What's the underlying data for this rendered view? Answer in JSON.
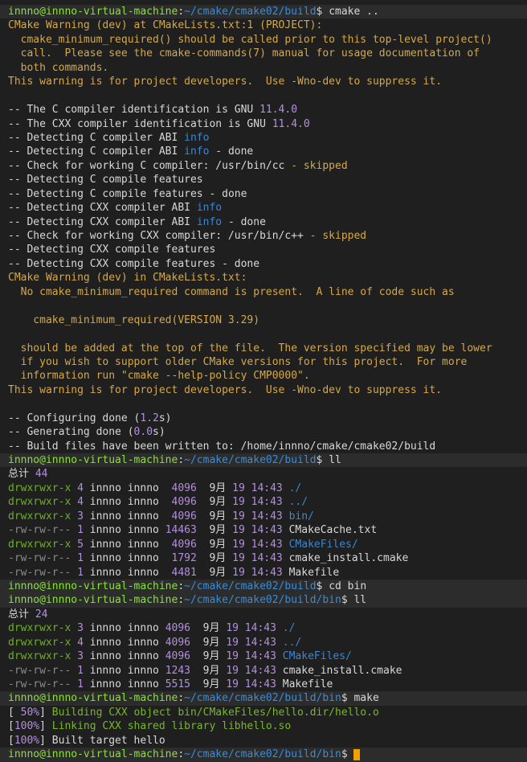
{
  "prompt": {
    "user_host": "innno@innno-virtual-machine",
    "path_build": "~/cmake/cmake02/build",
    "path_bin": "~/cmake/cmake02/build/bin"
  },
  "commands": [
    "cmake ..",
    "ll",
    "cd bin",
    "ll",
    "make"
  ],
  "cmake_output": [
    "CMake Warning (dev) at CMakeLists.txt:1 (PROJECT):",
    "  cmake_minimum_required() should be called prior to this top-level project()",
    "  call.  Please see the cmake-commands(7) manual for usage documentation of",
    "  both commands.",
    "This warning is for project developers.  Use -Wno-dev to suppress it.",
    "",
    "-- The C compiler identification is GNU 11.4.0",
    "-- The CXX compiler identification is GNU 11.4.0",
    "-- Detecting C compiler ABI info",
    "-- Detecting C compiler ABI info - done",
    "-- Check for working C compiler: /usr/bin/cc - skipped",
    "-- Detecting C compile features",
    "-- Detecting C compile features - done",
    "-- Detecting CXX compiler ABI info",
    "-- Detecting CXX compiler ABI info - done",
    "-- Check for working CXX compiler: /usr/bin/c++ - skipped",
    "-- Detecting CXX compile features",
    "-- Detecting CXX compile features - done",
    "CMake Warning (dev) in CMakeLists.txt:",
    "  No cmake_minimum_required command is present.  A line of code such as",
    "",
    "    cmake_minimum_required(VERSION 3.29)",
    "",
    "  should be added at the top of the file.  The version specified may be lower",
    "  if you wish to support older CMake versions for this project.  For more",
    "  information run \"cmake --help-policy CMP0000\".",
    "This warning is for project developers.  Use -Wno-dev to suppress it.",
    "",
    "-- Configuring done (1.2s)",
    "-- Generating done (0.0s)",
    "-- Build files have been written to: /home/innno/cmake/cmake02/build"
  ],
  "ll_build": {
    "total": "总计 44",
    "rows": [
      {
        "perm": "drwxrwxr-x",
        "links": "4",
        "owner": "innno",
        "group": "innno",
        "size": " 4096",
        "month": "9月",
        "day": "19",
        "time": "14:43",
        "name": "./",
        "type": "dir"
      },
      {
        "perm": "drwxrwxr-x",
        "links": "4",
        "owner": "innno",
        "group": "innno",
        "size": " 4096",
        "month": "9月",
        "day": "19",
        "time": "14:43",
        "name": "../",
        "type": "dir"
      },
      {
        "perm": "drwxrwxr-x",
        "links": "3",
        "owner": "innno",
        "group": "innno",
        "size": " 4096",
        "month": "9月",
        "day": "19",
        "time": "14:43",
        "name": "bin/",
        "type": "dir"
      },
      {
        "perm": "-rw-rw-r--",
        "links": "1",
        "owner": "innno",
        "group": "innno",
        "size": "14463",
        "month": "9月",
        "day": "19",
        "time": "14:43",
        "name": "CMakeCache.txt",
        "type": "file"
      },
      {
        "perm": "drwxrwxr-x",
        "links": "5",
        "owner": "innno",
        "group": "innno",
        "size": " 4096",
        "month": "9月",
        "day": "19",
        "time": "14:43",
        "name": "CMakeFiles/",
        "type": "dir"
      },
      {
        "perm": "-rw-rw-r--",
        "links": "1",
        "owner": "innno",
        "group": "innno",
        "size": " 1792",
        "month": "9月",
        "day": "19",
        "time": "14:43",
        "name": "cmake_install.cmake",
        "type": "file"
      },
      {
        "perm": "-rw-rw-r--",
        "links": "1",
        "owner": "innno",
        "group": "innno",
        "size": " 4481",
        "month": "9月",
        "day": "19",
        "time": "14:43",
        "name": "Makefile",
        "type": "file"
      }
    ]
  },
  "ll_bin": {
    "total": "总计 24",
    "rows": [
      {
        "perm": "drwxrwxr-x",
        "links": "3",
        "owner": "innno",
        "group": "innno",
        "size": "4096",
        "month": "9月",
        "day": "19",
        "time": "14:43",
        "name": "./",
        "type": "dir"
      },
      {
        "perm": "drwxrwxr-x",
        "links": "4",
        "owner": "innno",
        "group": "innno",
        "size": "4096",
        "month": "9月",
        "day": "19",
        "time": "14:43",
        "name": "../",
        "type": "dir"
      },
      {
        "perm": "drwxrwxr-x",
        "links": "3",
        "owner": "innno",
        "group": "innno",
        "size": "4096",
        "month": "9月",
        "day": "19",
        "time": "14:43",
        "name": "CMakeFiles/",
        "type": "dir"
      },
      {
        "perm": "-rw-rw-r--",
        "links": "1",
        "owner": "innno",
        "group": "innno",
        "size": "1243",
        "month": "9月",
        "day": "19",
        "time": "14:43",
        "name": "cmake_install.cmake",
        "type": "file"
      },
      {
        "perm": "-rw-rw-r--",
        "links": "1",
        "owner": "innno",
        "group": "innno",
        "size": "5515",
        "month": "9月",
        "day": "19",
        "time": "14:43",
        "name": "Makefile",
        "type": "file"
      }
    ]
  },
  "make_output": [
    {
      "pct": "[ 50%]",
      "msg": " Building CXX object bin/CMakeFiles/hello.dir/hello.o",
      "color": "green"
    },
    {
      "pct": "[100%]",
      "msg": " Linking CXX shared library libhello.so",
      "color": "green"
    },
    {
      "pct": "[100%]",
      "msg": " Built target hello",
      "color": "plain"
    }
  ],
  "colors": {
    "user": "#8ae234",
    "path": "#3b8bd8",
    "warning": "#d5a84a",
    "number": "#b58ee0",
    "info": "#3d86d0",
    "directory": "#3d86d0",
    "background": "#1e1f1e",
    "cursor": "#f0a000"
  }
}
